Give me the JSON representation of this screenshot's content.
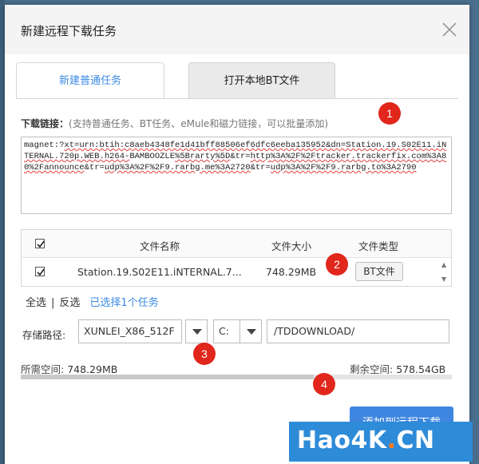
{
  "dialog": {
    "title": "新建远程下载任务"
  },
  "tabs": [
    {
      "label": "新建普通任务",
      "active": true
    },
    {
      "label": "打开本地BT文件",
      "active": false
    }
  ],
  "link": {
    "label": "下载链接：",
    "hint": "(支持普通任务、BT任务、eMule和磁力链接，可以批量添加)",
    "value_parts": [
      {
        "text": "magnet:?",
        "u": false
      },
      {
        "text": "xt=urn:btih:c8aeb4348fe1d41bff88506ef6dfc6eeba135952&dn=Station.19.S02E11.iNTERNAL.720p.WEB.h264-",
        "u": true
      },
      {
        "text": "BAMBOOZLE",
        "u": false
      },
      {
        "text": "%5Brarty%5D",
        "u": true
      },
      {
        "text": "&tr=",
        "u": false
      },
      {
        "text": "http",
        "u": true
      },
      {
        "text": "%3A%2F%2Ftracker.trackerfix.com%3A80%2Fannounce",
        "u": true
      },
      {
        "text": "&tr=",
        "u": false
      },
      {
        "text": "udp%3A%2F%2F9.rarbg.me%3A2720",
        "u": true
      },
      {
        "text": "&tr=",
        "u": false
      },
      {
        "text": "udp%3A%2F%2F9.rarbg.to%3A2790",
        "u": true
      }
    ]
  },
  "table": {
    "headers": {
      "name": "文件名称",
      "size": "文件大小",
      "type": "文件类型"
    },
    "rows": [
      {
        "checked": true,
        "name": "Station.19.S02E11.iNTERNAL.7...",
        "size": "748.29MB",
        "type": "BT文件"
      }
    ]
  },
  "selection": {
    "select_all": "全选",
    "separator": "|",
    "invert": "反选",
    "count_text": "已选择1个任务"
  },
  "storage": {
    "label": "存储路径:",
    "device": "XUNLEI_X86_512F",
    "drive": "C:",
    "directory": "/TDDOWNLOAD/"
  },
  "space": {
    "need_label": "所需空间:",
    "need_value": "748.29MB",
    "free_label": "剩余空间:",
    "free_value": "578.54GB",
    "used_fraction": 0.68
  },
  "actions": {
    "add_label": "添加到远程下载"
  },
  "markers": [
    "1",
    "2",
    "3",
    "4"
  ],
  "watermark": {
    "text_main": "Hao4K",
    "text_dot": ".",
    "text_tail": "CN"
  },
  "colors": {
    "accent": "#3b8ae4",
    "primary_button": "#3f86e0",
    "marker": "#e1261c",
    "background": "#4a6f8d"
  }
}
